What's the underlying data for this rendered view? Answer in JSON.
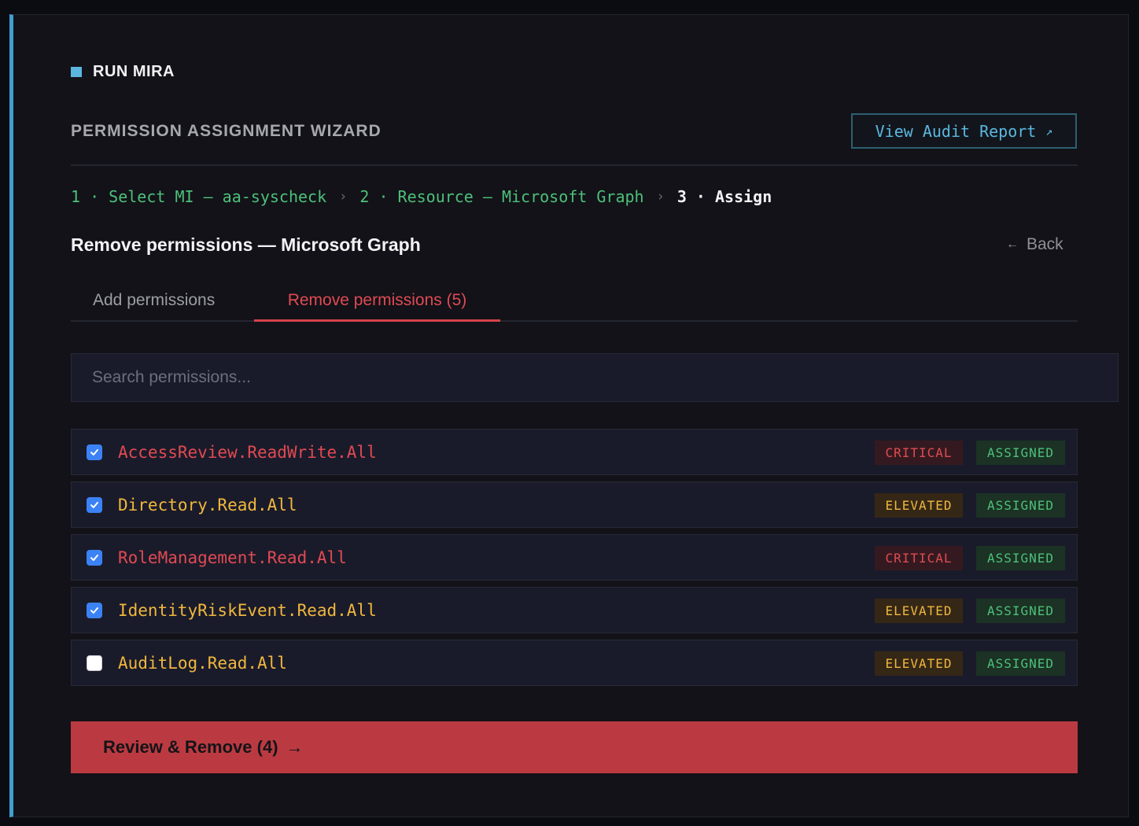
{
  "app": {
    "title": "RUN MIRA",
    "accent": "#3f9fd0"
  },
  "wizard": {
    "heading": "PERMISSION ASSIGNMENT WIZARD",
    "audit_button": "View Audit Report",
    "audit_icon": "↗"
  },
  "steps": [
    {
      "label": "1 · Select MI — aa-syscheck",
      "state": "done"
    },
    {
      "label": "2 · Resource — Microsoft Graph",
      "state": "done"
    },
    {
      "label": "3 · Assign",
      "state": "current"
    }
  ],
  "step_separator": "›",
  "section": {
    "title": "Remove permissions — Microsoft Graph",
    "back_icon": "←",
    "back_label": "Back"
  },
  "tabs": [
    {
      "label": "Add permissions",
      "active": false
    },
    {
      "label": "Remove permissions (5)",
      "active": true
    }
  ],
  "search": {
    "placeholder": "Search permissions...",
    "value": ""
  },
  "permissions": [
    {
      "name": "AccessReview.ReadWrite.All",
      "level": "CRITICAL",
      "status": "ASSIGNED",
      "checked": true
    },
    {
      "name": "Directory.Read.All",
      "level": "ELEVATED",
      "status": "ASSIGNED",
      "checked": true
    },
    {
      "name": "RoleManagement.Read.All",
      "level": "CRITICAL",
      "status": "ASSIGNED",
      "checked": true
    },
    {
      "name": "IdentityRiskEvent.Read.All",
      "level": "ELEVATED",
      "status": "ASSIGNED",
      "checked": true
    },
    {
      "name": "AuditLog.Read.All",
      "level": "ELEVATED",
      "status": "ASSIGNED",
      "checked": false
    }
  ],
  "cta": {
    "label": "Review & Remove (4)",
    "icon": "→",
    "color": "#bb3a41"
  },
  "colors": {
    "critical": "#e04a53",
    "elevated": "#f0b73e",
    "assigned": "#4ec07a",
    "link": "#5bb7e0"
  }
}
